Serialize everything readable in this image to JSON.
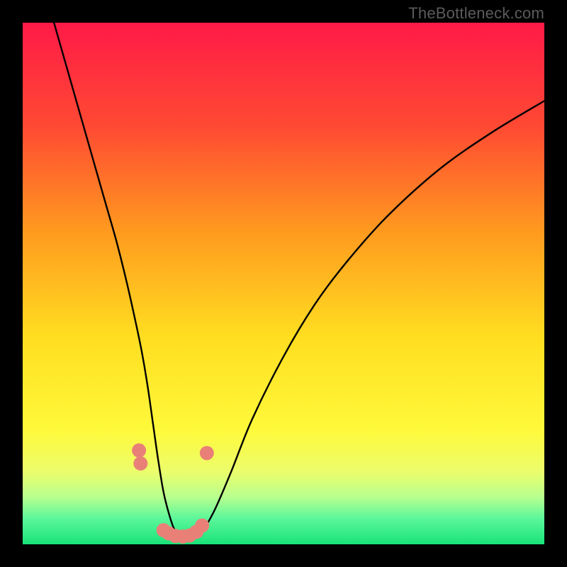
{
  "watermark": "TheBottleneck.com",
  "chart_data": {
    "type": "line",
    "title": "",
    "xlabel": "",
    "ylabel": "",
    "xlim": [
      0,
      100
    ],
    "ylim": [
      0,
      100
    ],
    "gradient_stops": [
      {
        "offset": 0.0,
        "color": "#ff1a47"
      },
      {
        "offset": 0.2,
        "color": "#ff4a33"
      },
      {
        "offset": 0.4,
        "color": "#ff9a1f"
      },
      {
        "offset": 0.6,
        "color": "#ffdd20"
      },
      {
        "offset": 0.78,
        "color": "#fff93a"
      },
      {
        "offset": 0.86,
        "color": "#ecfd6b"
      },
      {
        "offset": 0.91,
        "color": "#b7ff8f"
      },
      {
        "offset": 0.95,
        "color": "#5cf79a"
      },
      {
        "offset": 1.0,
        "color": "#19e37a"
      }
    ],
    "series": [
      {
        "name": "bottleneck-curve",
        "x": [
          6,
          8,
          10,
          12,
          14,
          16,
          18,
          20,
          22,
          23,
          24,
          25,
          26,
          27,
          28,
          29,
          30,
          31,
          32,
          33,
          34,
          35,
          37,
          40,
          44,
          50,
          56,
          62,
          70,
          80,
          90,
          100
        ],
        "y": [
          100,
          93,
          86,
          79,
          72,
          65,
          58,
          50,
          41,
          36,
          30,
          23,
          16,
          10,
          6,
          3,
          1.5,
          1,
          1,
          1.3,
          2,
          3.3,
          7,
          14,
          24,
          36,
          46,
          54,
          63,
          72,
          79,
          85
        ]
      }
    ],
    "markers": {
      "name": "highlight-dots",
      "color": "#e98078",
      "radius_px": 10,
      "points": [
        {
          "x": 22.3,
          "y": 18
        },
        {
          "x": 22.6,
          "y": 15.5
        },
        {
          "x": 27.0,
          "y": 2.7
        },
        {
          "x": 28.0,
          "y": 2.1
        },
        {
          "x": 29.3,
          "y": 1.6
        },
        {
          "x": 30.7,
          "y": 1.5
        },
        {
          "x": 32.0,
          "y": 1.7
        },
        {
          "x": 33.3,
          "y": 2.4
        },
        {
          "x": 34.4,
          "y": 3.6
        },
        {
          "x": 35.3,
          "y": 17.5
        }
      ]
    }
  }
}
